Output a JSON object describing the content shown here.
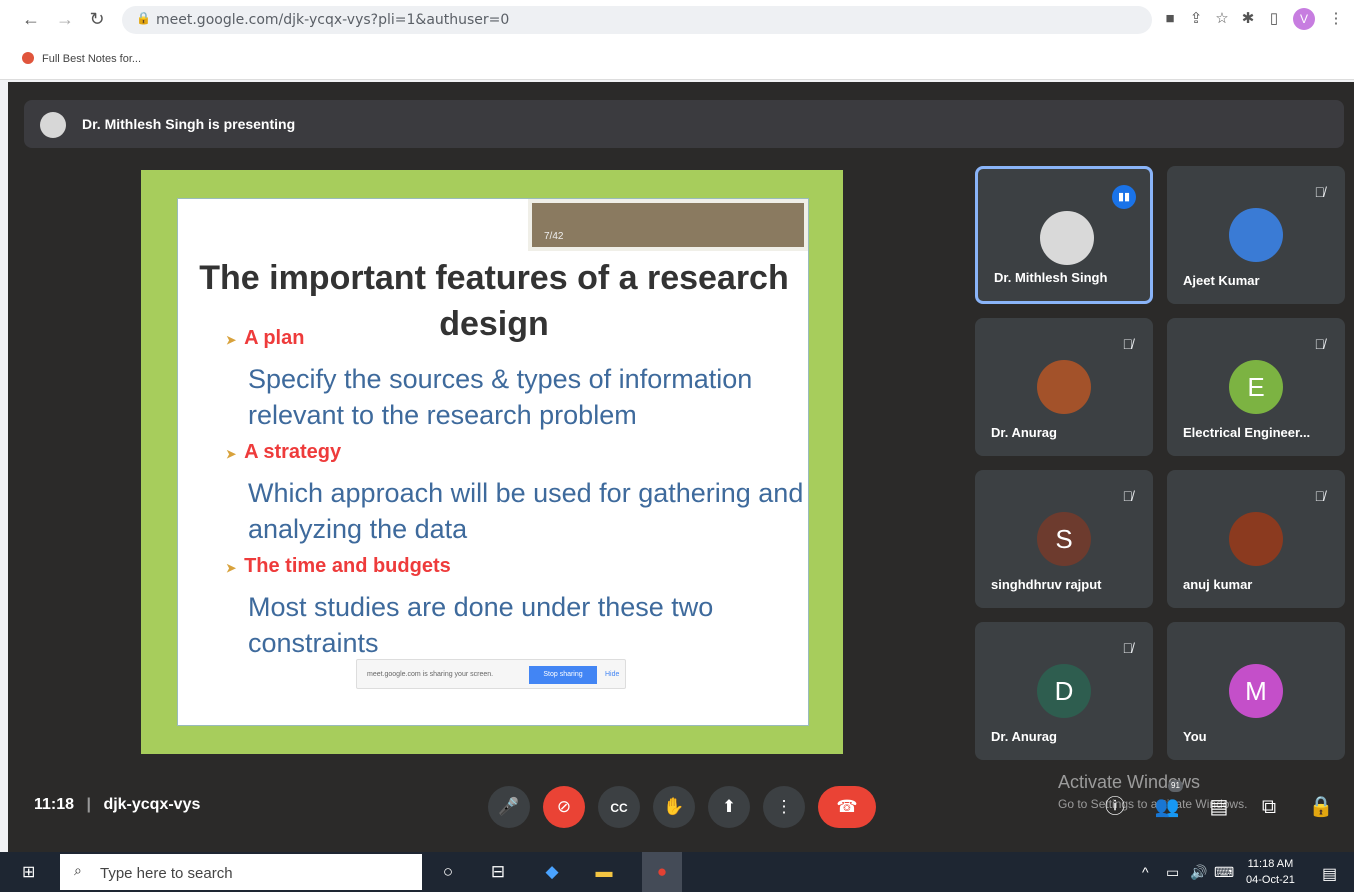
{
  "browser": {
    "back_icon": "arrow-left-icon",
    "url": "meet.google.com/djk-ycqx-vys?pli=1&authuser=0",
    "profile_initial": "V"
  },
  "bookmarks": [
    {
      "label": "Full Best Notes for..."
    }
  ],
  "meet": {
    "presenting_text": "Dr. Mithlesh Singh is presenting",
    "slide": {
      "page_indicator": "7/42",
      "title": "The important features of a research design",
      "sections": [
        {
          "heading": "A plan",
          "body": "Specify the sources & types of information relevant to the research problem"
        },
        {
          "heading": "A strategy",
          "body": "Which approach will be used for gathering and analyzing the data"
        },
        {
          "heading": "The time and budgets",
          "body": "Most studies are done under these two constraints"
        }
      ],
      "share_notice": "meet.google.com is sharing your screen.",
      "stop_sharing": "Stop sharing",
      "hide": "Hide"
    },
    "participants": [
      {
        "name": "Dr. Mithlesh Singh",
        "avatar": "photo",
        "color": "#d9d9d9",
        "muted": false,
        "speaking": true
      },
      {
        "name": "Ajeet Kumar",
        "avatar": "photo",
        "color": "#3a7bd5",
        "muted": true,
        "speaking": false
      },
      {
        "name": "Dr. Anurag",
        "avatar": "photo",
        "color": "#a3522a",
        "muted": true,
        "speaking": false
      },
      {
        "name": "Electrical Engineer...",
        "avatar": "E",
        "color": "#7cb342",
        "muted": true,
        "speaking": false
      },
      {
        "name": "singhdhruv rajput",
        "avatar": "S",
        "color": "#6d3b2e",
        "muted": true,
        "speaking": false
      },
      {
        "name": "anuj kumar",
        "avatar": "photo",
        "color": "#8b3a1f",
        "muted": true,
        "speaking": false
      },
      {
        "name": "Dr. Anurag",
        "avatar": "D",
        "color": "#2e5d4f",
        "muted": true,
        "speaking": false
      },
      {
        "name": "You",
        "avatar": "M",
        "color": "#c44fc9",
        "muted": false,
        "speaking": false
      }
    ],
    "controls": {
      "time": "11:18",
      "separator": "|",
      "meeting_code": "djk-ycqx-vys",
      "buttons": [
        "mic-icon",
        "camera-off-icon",
        "captions-icon",
        "raise-hand-icon",
        "present-icon",
        "more-icon",
        "end-call-icon"
      ],
      "side": [
        "info-icon",
        "people-icon",
        "chat-icon",
        "activities-icon",
        "host-controls-icon"
      ],
      "people_count": "91"
    },
    "watermark": {
      "line1": "Activate Windows",
      "line2": "Go to Settings to activate Windows."
    }
  },
  "taskbar": {
    "search_placeholder": "Type here to search",
    "time": "11:18 AM",
    "date": "04-Oct-21"
  }
}
